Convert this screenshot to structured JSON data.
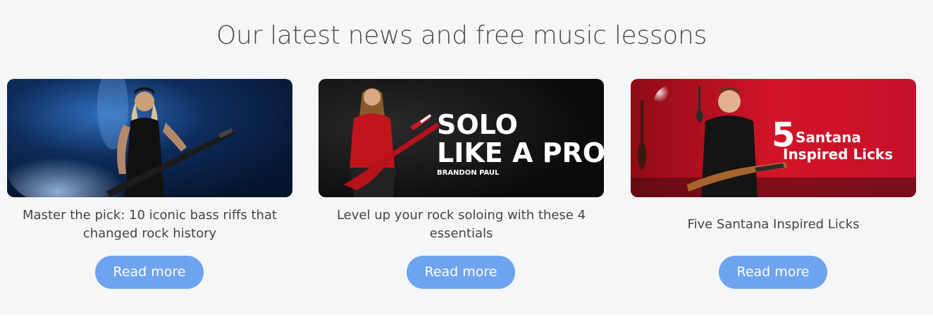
{
  "section": {
    "title": "Our latest news and free music lessons"
  },
  "cards": [
    {
      "image_alt": "Bassist performing on stage with blue lighting",
      "title": "Master the pick: 10 iconic bass riffs that changed rock history",
      "button_label": "Read more"
    },
    {
      "image_alt": "Guitarist playing a red guitar",
      "image_text_line1": "SOLO",
      "image_text_line2": "LIKE A PRO",
      "image_caption": "BRANDON PAUL",
      "title": "Level up your rock soloing with these 4 essentials",
      "button_label": "Read more"
    },
    {
      "image_alt": "Guitarist in a studio with a red wall",
      "image_number": "5",
      "image_text_line1": "Santana",
      "image_text_line2": "Inspired Licks",
      "title": "Five Santana Inspired Licks",
      "button_label": "Read more"
    }
  ],
  "colors": {
    "background": "#f5f6f8",
    "button": "#6ea3f0",
    "heading": "#4a4a4a"
  }
}
